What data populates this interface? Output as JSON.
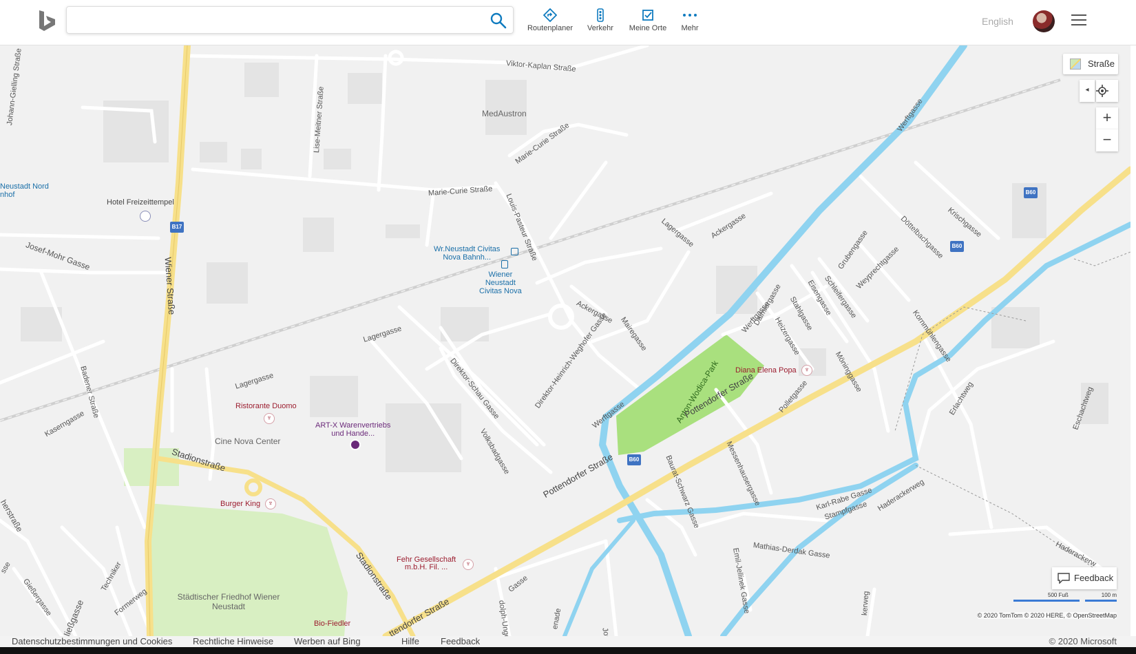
{
  "header": {
    "search_placeholder": "",
    "nav": {
      "routes": "Routenplaner",
      "traffic": "Verkehr",
      "places": "Meine Orte",
      "more": "Mehr"
    },
    "language": "English"
  },
  "map": {
    "style_label": "Straße",
    "feedback_label": "Feedback",
    "scale": {
      "imperial": "500 Fuß",
      "metric": "100 m"
    },
    "attribution": "© 2020 TomTom © 2020 HERE, © OpenStreetMap",
    "streets": {
      "viktor_kaplan": "Viktor-Kaplan Straße",
      "marie_curie_1": "Marie-Curie Straße",
      "marie_curie_2": "Marie-Curie Straße",
      "louis_pasteur": "Louis-Pasteur Straße",
      "lise_meitner": "Lise-Meitner Straße",
      "johann_gielling": "Johann-Gielling Straße",
      "josef_mohr": "Josef-Mohr Gasse",
      "wiener": "Wiener Straße",
      "badener": "Badener Straße",
      "kasern": "Kaserngasse",
      "lager_1": "Lagergasse",
      "lager_2": "Lagergasse",
      "lager_3": "Lagergasse",
      "acker_1": "Ackergasse",
      "acker_2": "Ackergasse",
      "werft_1": "Werftgasse",
      "werft_2": "Werftgasse",
      "werft_3": "Werftgasse",
      "direktor_schau": "Direktor-Schau Gasse",
      "direktor_weghofer": "Direktor-Heinrich-Weghofer Gasse",
      "maire": "Mairegasse",
      "volksbad": "Volksbadgasse",
      "stadion_1": "Stadionstraße",
      "stadion_2": "Stadionstraße",
      "pottendorfer_1": "Pottendorfer Straße",
      "pottendorfer_2": "Pottendorfer Straße",
      "pottendorfer_3": "ttendorfer Straße",
      "doettelbach": "Döttelbachgasse",
      "krisch": "Krischgasse",
      "gruben": "Grubengasse",
      "schleifer": "Schleifergasse",
      "weyprecht": "Weyprechtgasse",
      "eisen": "Eisengasse",
      "stahl": "Stahlgasse",
      "heizer": "Heizergasse",
      "daimler": "Daimlergasse",
      "moenning": "Möninggasse",
      "kornmuehl": "Kornmühlengasse",
      "pollet": "Polletgasse",
      "messenhauser": "Messenhausergasse",
      "baurat": "Baurat-Schwarz Gasse",
      "karl_rabe": "Karl-Rabe Gasse",
      "stampf": "Stampfgasse",
      "haderacker_1": "Haderackerweg",
      "haderacker_2": "Haderackerw",
      "mathias_derdak": "Mathias-Derdak Gasse",
      "emil_jellinek": "Emil-Jellinek Gasse",
      "erlach": "Erlachtweg",
      "eschacht": "Eschachtweg",
      "technik": "Techniker",
      "former": "Formerweg",
      "giesser": "Gießergasse",
      "niess": "Nießgasse",
      "joseph": "Josef-",
      "dolpi": "dolph-Unger",
      "gasse_small": "Gasse",
      "kerweg": "kerweg",
      "enade": "enade",
      "bahn_str": "herstraße",
      "sse": "sse"
    },
    "areas": {
      "medaustron": "MedAustron",
      "cine_nova": "Cine Nova Center",
      "friedhof": "Städtischer Friedhof Wiener Neustadt",
      "park": "Anton-Wodica-Park"
    },
    "pois": {
      "hotel": "Hotel Freizeittempel",
      "station_nord": "Neustadt Nord\nnhof",
      "civitas_bahn": "Wr.Neustadt Civitas\nNova Bahnh...",
      "civitas_nova": "Wiener\nNeustadt\nCivitas Nova",
      "duomo": "Ristorante Duomo",
      "artx": "ART-X Warenvertriebs\nund Hande...",
      "burger": "Burger King",
      "fehr": "Fehr Gesellschaft\nm.b.H. Fil. ...",
      "bio": "Bio-Fiedler",
      "diana": "Diana Elena Popa"
    },
    "shields": {
      "b17": "B17",
      "b60_1": "B60",
      "b60_2": "B60",
      "b60_3": "B60"
    }
  },
  "footer": {
    "privacy": "Datenschutzbestimmungen und Cookies",
    "legal": "Rechtliche Hinweise",
    "ads": "Werben auf Bing",
    "help": "Hilfe",
    "feedback": "Feedback",
    "copyright": "© 2020 Microsoft"
  },
  "colors": {
    "water": "#8fd3f0",
    "major_road": "#f7e08a",
    "park": "#a9e07e",
    "cemetery": "#d8efc2",
    "bing_blue": "#0f7bbf"
  }
}
